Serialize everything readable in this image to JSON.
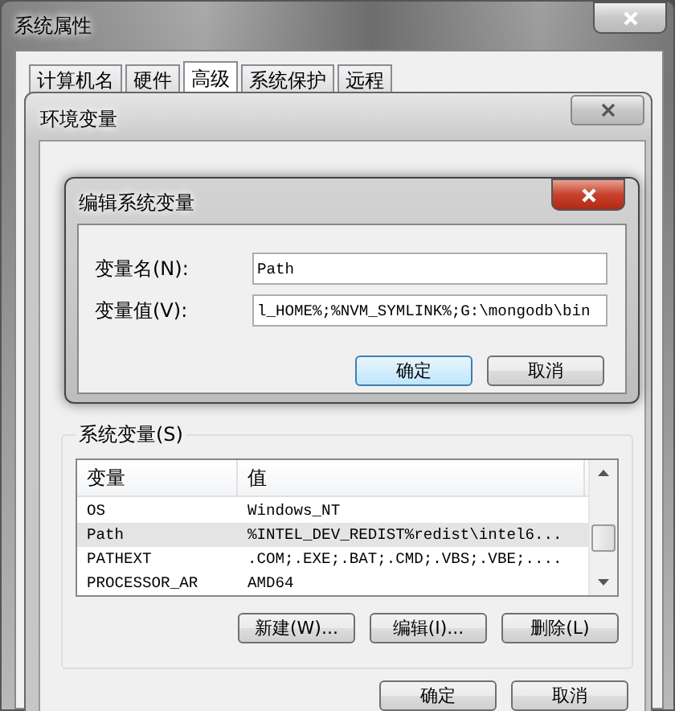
{
  "window": {
    "title": "系统属性"
  },
  "tabs": [
    {
      "label": "计算机名",
      "selected": false
    },
    {
      "label": "硬件",
      "selected": false
    },
    {
      "label": "高级",
      "selected": true
    },
    {
      "label": "系统保护",
      "selected": false
    },
    {
      "label": "远程",
      "selected": false
    }
  ],
  "env_window": {
    "title": "环境变量"
  },
  "edit_dialog": {
    "title": "编辑系统变量",
    "fields": [
      {
        "label": "变量名(N):",
        "value": "Path"
      },
      {
        "label": "变量值(V):",
        "value": "l_HOME%;%NVM_SYMLINK%;G:\\mongodb\\bin"
      }
    ],
    "buttons": [
      {
        "label": "确定",
        "default": true
      },
      {
        "label": "取消",
        "default": false
      }
    ]
  },
  "system_vars": {
    "title": "系统变量(S)",
    "columns": [
      "变量",
      "值"
    ],
    "rows": [
      {
        "name": "OS",
        "value": "Windows_NT",
        "selected": false
      },
      {
        "name": "Path",
        "value": "%INTEL_DEV_REDIST%redist\\intel6...",
        "selected": true
      },
      {
        "name": "PATHEXT",
        "value": ".COM;.EXE;.BAT;.CMD;.VBS;.VBE;....",
        "selected": false
      },
      {
        "name": "PROCESSOR_AR",
        "value": "AMD64",
        "selected": false
      }
    ],
    "buttons": [
      "新建(W)...",
      "编辑(I)...",
      "删除(L)"
    ]
  },
  "env_buttons": [
    "确定",
    "取消"
  ]
}
